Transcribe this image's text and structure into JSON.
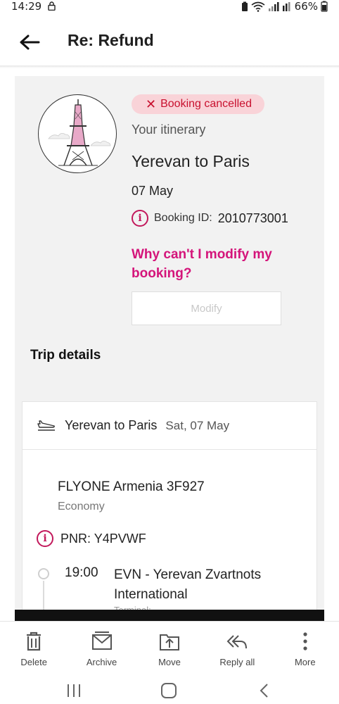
{
  "status_bar": {
    "time": "14:29",
    "battery": "66%"
  },
  "app_bar": {
    "title": "Re: Refund"
  },
  "email": {
    "badge": "Booking cancelled",
    "itinerary_label": "Your itinerary",
    "route": "Yerevan to Paris",
    "date": "07 May",
    "booking_id_label": "Booking ID:",
    "booking_id": "2010773001",
    "why_link": "Why can't I modify my booking?",
    "modify_button": "Modify",
    "trip_details_label": "Trip details",
    "card": {
      "route": "Yerevan to Paris",
      "day": "Sat, 07 May",
      "flight": "FLYONE Armenia 3F927",
      "cabin": "Economy",
      "pnr_label": "PNR:",
      "pnr": "Y4PVWF",
      "dep_time": "19:00",
      "dep_airport": "EVN - Yerevan Zvartnots International",
      "terminal_label": "Terminal:"
    },
    "accent_color": "#d4147a",
    "badge_color": "#c8102e"
  },
  "toolbar": {
    "delete": "Delete",
    "archive": "Archive",
    "move": "Move",
    "reply_all": "Reply all",
    "more": "More"
  }
}
